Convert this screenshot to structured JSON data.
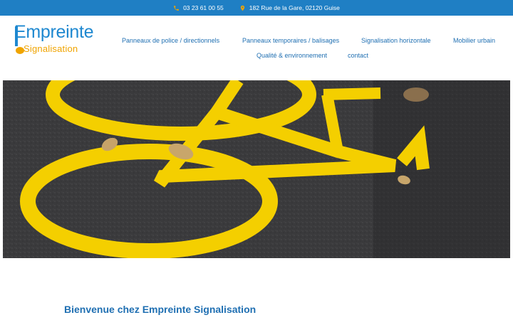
{
  "topbar": {
    "phone": "03 23 61 00 55",
    "address": "182 Rue de la Gare, 02120 Guise"
  },
  "logo": {
    "line1": "Empreinte",
    "line2": "Signalisation"
  },
  "nav": {
    "items": [
      {
        "label": "Panneaux de police / directionnels"
      },
      {
        "label": "Panneaux temporaires / balisages"
      },
      {
        "label": "Signalisation horizontale"
      },
      {
        "label": "Mobilier urbain"
      },
      {
        "label": "Qualité & environnement"
      },
      {
        "label": "contact"
      }
    ]
  },
  "main": {
    "welcome": "Bienvenue chez Empreinte Signalisation"
  },
  "colors": {
    "primary": "#1f7fc4",
    "accent": "#f0a400",
    "hero_paint": "#f4cf00"
  },
  "icons": {
    "phone": "phone-icon",
    "location": "map-pin-icon"
  }
}
